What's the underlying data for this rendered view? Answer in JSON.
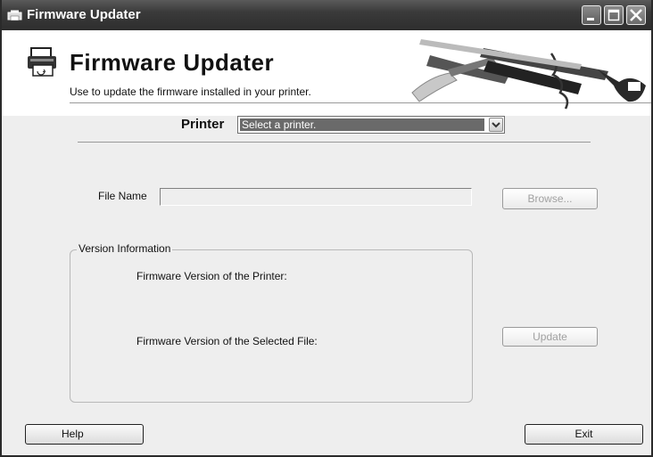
{
  "window": {
    "title": "Firmware Updater",
    "controls": {
      "minimize": "minimize-icon",
      "maximize": "maximize-icon",
      "close": "close-icon"
    }
  },
  "banner": {
    "title": "Firmware Updater",
    "subtitle": "Use to update the firmware installed in your printer."
  },
  "printer": {
    "label": "Printer",
    "selected": "Select a printer.",
    "dropdown_icon": "chevron-down-icon"
  },
  "file": {
    "label": "File Name",
    "value": "",
    "browse_label": "Browse..."
  },
  "version_info": {
    "legend": "Version Information",
    "printer_version_label": "Firmware Version of the Printer:",
    "file_version_label": "Firmware Version of the Selected File:",
    "update_label": "Update"
  },
  "footer": {
    "help_label": "Help",
    "exit_label": "Exit"
  },
  "colors": {
    "titlebar": "#3a3a3a",
    "window_bg": "#eeeeee",
    "selected_bg": "#6a6a6a"
  }
}
